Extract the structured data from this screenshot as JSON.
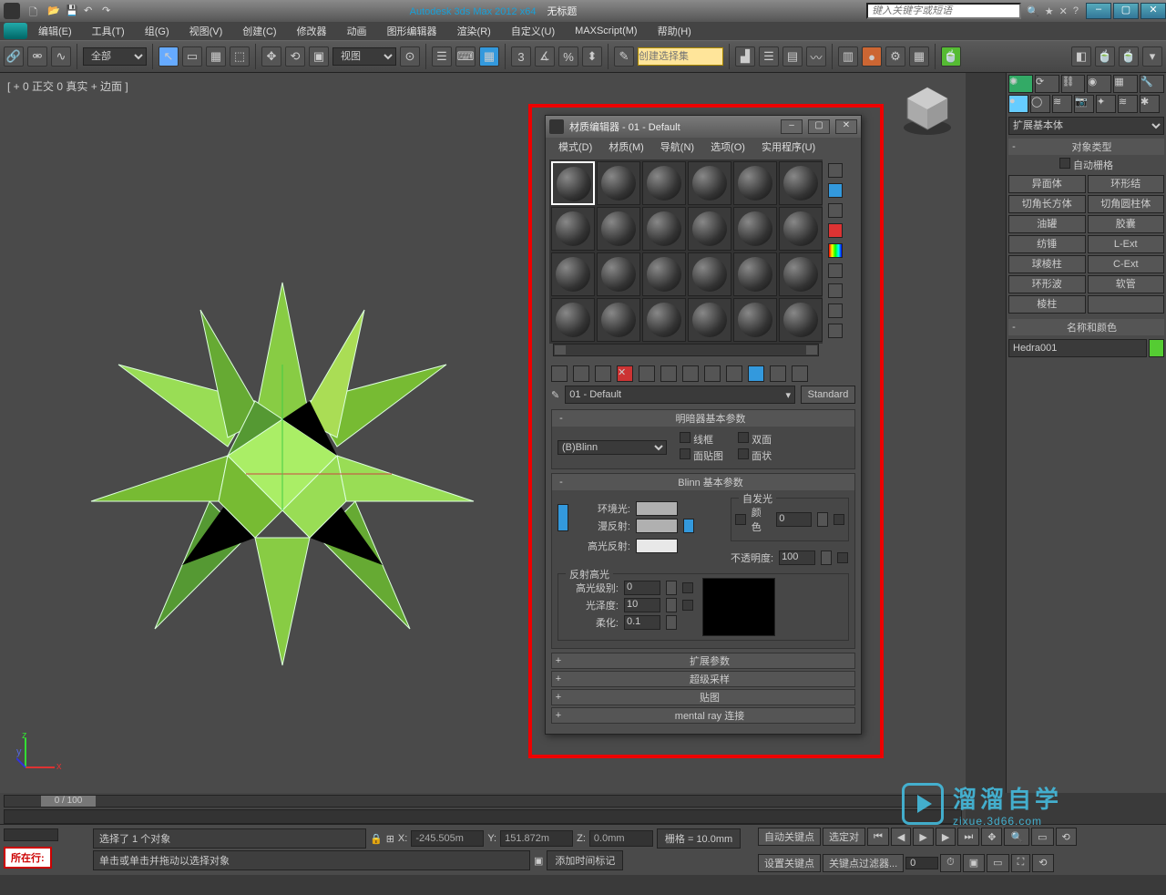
{
  "titlebar": {
    "app": "Autodesk 3ds Max 2012 x64",
    "doc": "无标题",
    "search_ph": "键入关键字或短语"
  },
  "menus": [
    "编辑(E)",
    "工具(T)",
    "组(G)",
    "视图(V)",
    "创建(C)",
    "修改器",
    "动画",
    "图形编辑器",
    "渲染(R)",
    "自定义(U)",
    "MAXScript(M)",
    "帮助(H)"
  ],
  "toolbar": {
    "filter": "全部",
    "refsys": "视图"
  },
  "viewport_label": "[ + 0 正交 0 真实 + 边面 ]",
  "mateditor": {
    "title": "材质编辑器 - 01 - Default",
    "menus": [
      "模式(D)",
      "材质(M)",
      "导航(N)",
      "选项(O)",
      "实用程序(U)"
    ],
    "matname": "01 - Default",
    "mattype": "Standard",
    "shader": "(B)Blinn",
    "rollout_shader": "明暗器基本参数",
    "rollout_blinn": "Blinn 基本参数",
    "chk_wire": "线框",
    "chk_2side": "双面",
    "chk_facemap": "面贴图",
    "chk_faceted": "面状",
    "lbl_ambient": "环境光:",
    "lbl_diffuse": "漫反射:",
    "lbl_spec": "高光反射:",
    "grp_selfillum": "自发光",
    "lbl_color": "颜色",
    "val_selfillum": "0",
    "lbl_opacity": "不透明度:",
    "val_opacity": "100",
    "grp_hl": "反射高光",
    "lbl_speclevel": "高光级别:",
    "val_speclevel": "0",
    "lbl_gloss": "光泽度:",
    "val_gloss": "10",
    "lbl_soften": "柔化:",
    "val_soften": "0.1",
    "bars": [
      "扩展参数",
      "超级采样",
      "贴图",
      "mental ray 连接"
    ]
  },
  "cmdpanel": {
    "category": "扩展基本体",
    "rollout_objtype": "对象类型",
    "autogrid": "自动栅格",
    "buttons": [
      "异面体",
      "环形结",
      "切角长方体",
      "切角圆柱体",
      "油罐",
      "胶囊",
      "纺锤",
      "L-Ext",
      "球棱柱",
      "C-Ext",
      "环形波",
      "软管",
      "棱柱",
      ""
    ],
    "rollout_name": "名称和颜色",
    "objname": "Hedra001"
  },
  "timeline": {
    "slider": "0 / 100"
  },
  "status": {
    "sel": "选择了 1 个对象",
    "hint": "单击或单击并拖动以选择对象",
    "now": "所在行:",
    "x": "-245.505m",
    "y": "151.872m",
    "z": "0.0mm",
    "grid": "栅格 = 10.0mm",
    "autokey": "自动关键点",
    "setkey": "设置关键点",
    "selkey": "选定对",
    "keyfilter": "关键点过滤器...",
    "addtime": "添加时间标记"
  },
  "watermark": {
    "t1": "溜溜自学",
    "t2": "zixue.3d66.com"
  }
}
